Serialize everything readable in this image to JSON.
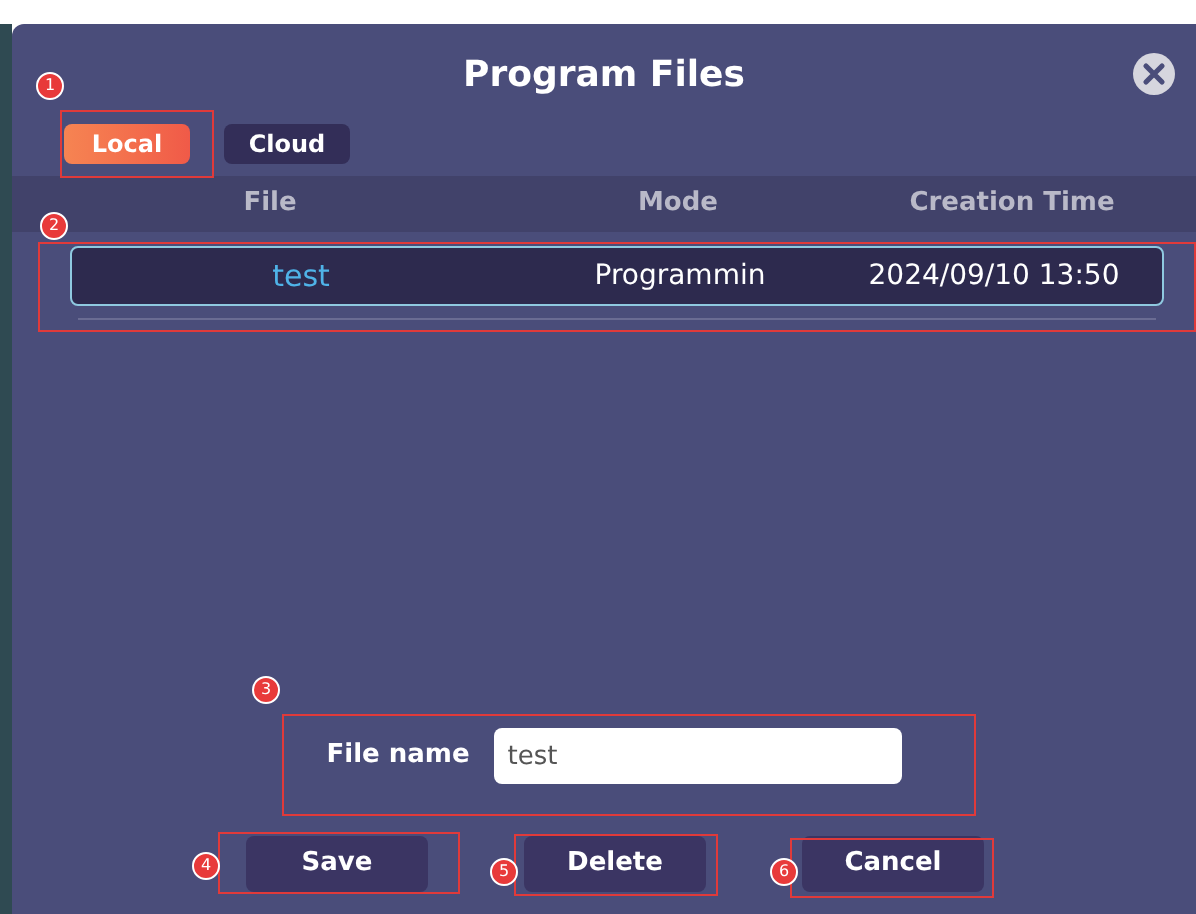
{
  "dialog": {
    "title": "Program Files"
  },
  "tabs": [
    {
      "label": "Local",
      "selected": true
    },
    {
      "label": "Cloud",
      "selected": false
    }
  ],
  "table": {
    "columns": [
      "File",
      "Mode",
      "Creation Time"
    ],
    "rows": [
      {
        "cells": [
          "test",
          "Programmin",
          "2024/09/10 13:50"
        ],
        "selected": true
      }
    ]
  },
  "file_name": {
    "label": "File name",
    "value": "test"
  },
  "buttons": [
    "Save",
    "Delete",
    "Cancel"
  ],
  "annotations": [
    "1",
    "2",
    "3",
    "4",
    "5",
    "6"
  ]
}
